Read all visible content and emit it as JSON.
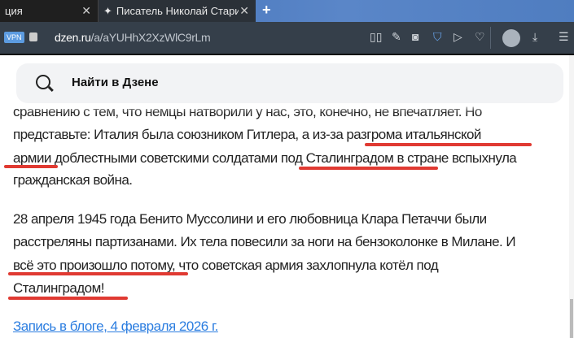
{
  "tabs": [
    {
      "label": "ция"
    },
    {
      "label": "Писатель Николай Старик"
    }
  ],
  "address": {
    "vpn": "VPN",
    "domain": "dzen.ru",
    "path": "/a/aYUHhX2XzWlC9rLm"
  },
  "search": {
    "placeholder": "Найти в Дзене"
  },
  "article": {
    "lines": [
      "сравнению с тем, что немцы натворили у нас, это, конечно, не впечатляет. Но",
      "представьте: Италия была союзником Гитлера, а из-за разгрома итальянской",
      "армии доблестными советскими солдатами под Сталинградом в стране вспыхнула",
      "гражданская война.",
      "28 апреля 1945 года Бенито Муссолини и его любовница Клара Петаччи были",
      "расстреляны партизанами. Их тела повесили за ноги на бензоколонке в Милане. И",
      "всё это произошло потому, что советская армия захлопнула котёл под",
      "Сталинградом!"
    ],
    "link": "Запись в блоге, 4 февраля 2026 г."
  },
  "colors": {
    "underline": "#e03a32",
    "link": "#2b7de0"
  }
}
